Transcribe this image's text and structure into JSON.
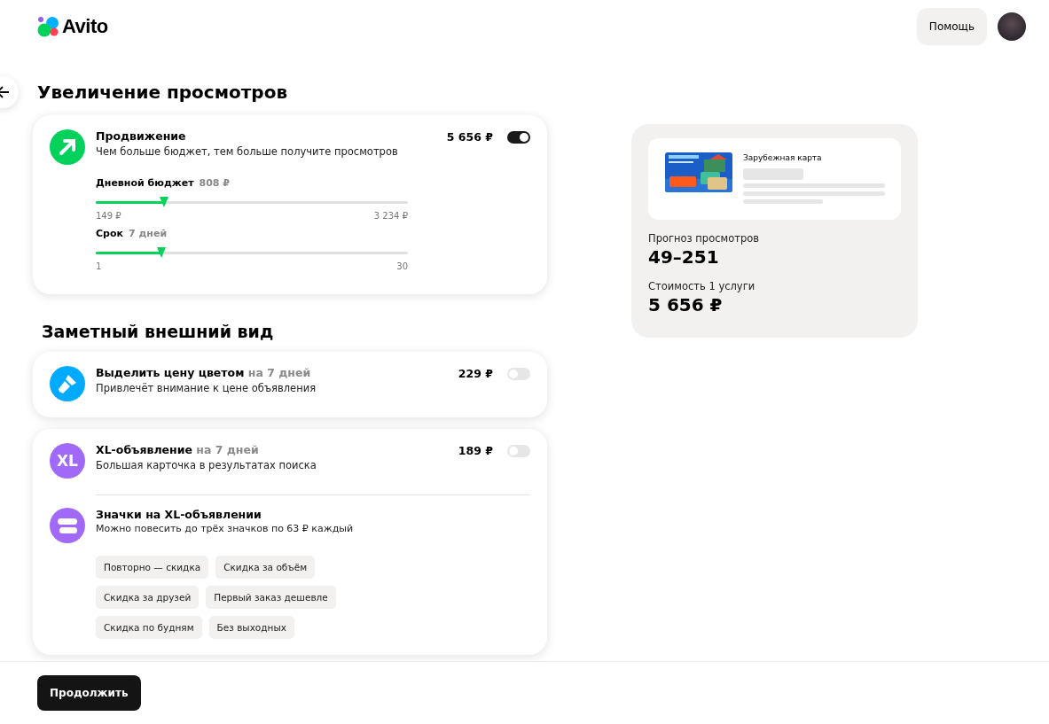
{
  "header": {
    "logo": "Avito",
    "help_button": "Помощь"
  },
  "title": "Увеличение просмотров",
  "promotion": {
    "title": "Продвижение",
    "subtitle": "Чем больше бюджет, тем больше получите просмотров",
    "price": "5 656 ₽",
    "on": true,
    "sliders": [
      {
        "label": "Дневной бюджет",
        "value": "808 ₽",
        "level": 0.22,
        "min": "149 ₽",
        "max": "3 234 ₽"
      },
      {
        "label": "Срок",
        "value": "7 дней",
        "level": 0.21,
        "min": "1",
        "max": "30"
      }
    ]
  },
  "section_title": "Заметный внешний вид",
  "services": [
    {
      "kind": "brush",
      "color": "#00aaff",
      "title": "Выделить цену цветом",
      "period": "на 7 дней",
      "subtitle": "Привлечёт внимание к цене объявления",
      "price": "229 ₽",
      "on": false
    },
    {
      "kind": "xl",
      "color": "#a169f7",
      "icon_text": "XL",
      "title": "XL-объявление",
      "period": "на 7 дней",
      "subtitle": "Большая карточка в результатах поиска",
      "price": "189 ₽",
      "on": false,
      "sub": {
        "title": "Значки на XL-объявлении",
        "subtitle": "Можно повесить до трёх значков по 63 ₽ каждый",
        "chips": [
          [
            "Повторно — скидка",
            "Скидка за объём"
          ],
          [
            "Скидка за друзей",
            "Первый заказ дешевле"
          ],
          [
            "Скидка по будням",
            "Без выходных"
          ]
        ]
      }
    }
  ],
  "preview": {
    "ad_title": "Зарубежная карта",
    "forecast_label": "Прогноз просмотров",
    "forecast": "49–251",
    "cost_label": "Стоимость 1 услуги",
    "cost": "5 656 ₽"
  },
  "continue_button": "Продолжить"
}
